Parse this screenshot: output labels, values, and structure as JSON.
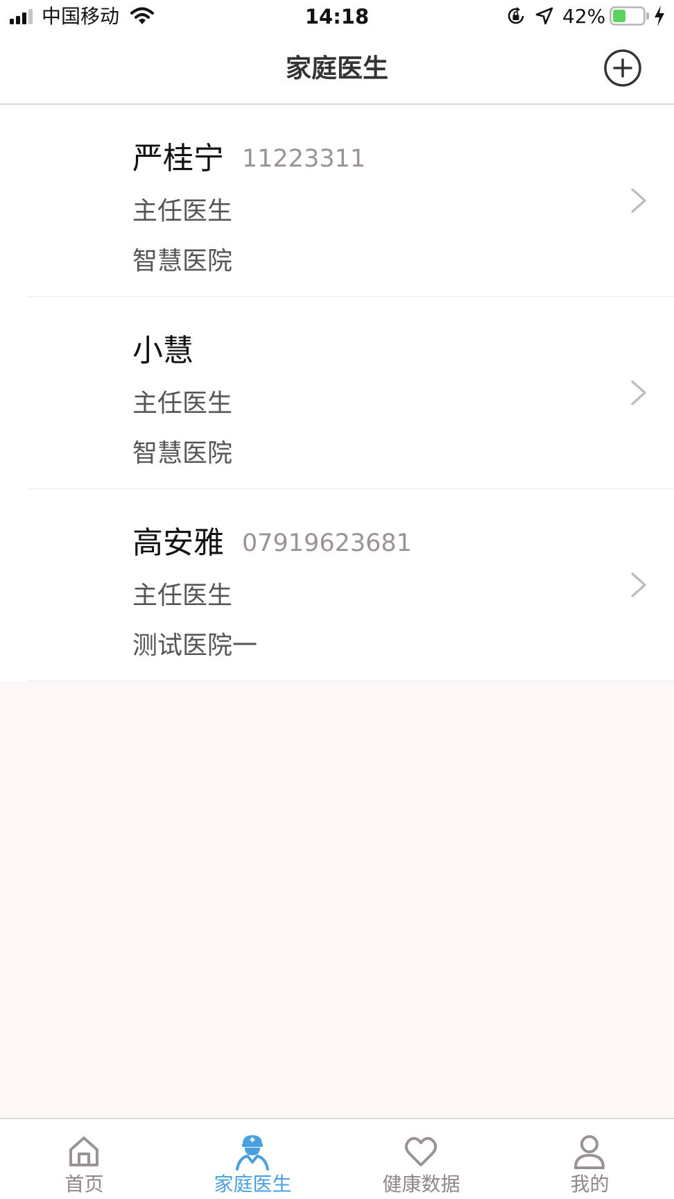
{
  "status_bar": {
    "carrier": "中国移动",
    "time": "14:18",
    "battery_percent": "42%",
    "battery_level": 0.42,
    "battery_color": "#5cd35c",
    "icons": [
      "signal-icon",
      "wifi-icon",
      "orientation-lock-icon",
      "location-icon",
      "battery-icon",
      "charging-icon"
    ]
  },
  "nav": {
    "title": "家庭医生",
    "add_icon": "plus-circle-icon"
  },
  "doctors": [
    {
      "name": "严桂宁",
      "phone": "11223311",
      "title": "主任医生",
      "hospital": "智慧医院"
    },
    {
      "name": "小慧",
      "phone": "",
      "title": "主任医生",
      "hospital": "智慧医院"
    },
    {
      "name": "高安雅",
      "phone": "07919623681",
      "title": "主任医生",
      "hospital": "测试医院一"
    }
  ],
  "tabs": [
    {
      "label": "首页",
      "icon": "home-icon",
      "active": false
    },
    {
      "label": "家庭医生",
      "icon": "doctor-icon",
      "active": true
    },
    {
      "label": "健康数据",
      "icon": "heart-icon",
      "active": false
    },
    {
      "label": "我的",
      "icon": "user-icon",
      "active": false
    }
  ],
  "colors": {
    "accent": "#4a9fe0",
    "inactive_tab": "#8e8688",
    "page_background": "#fdf7f7"
  }
}
